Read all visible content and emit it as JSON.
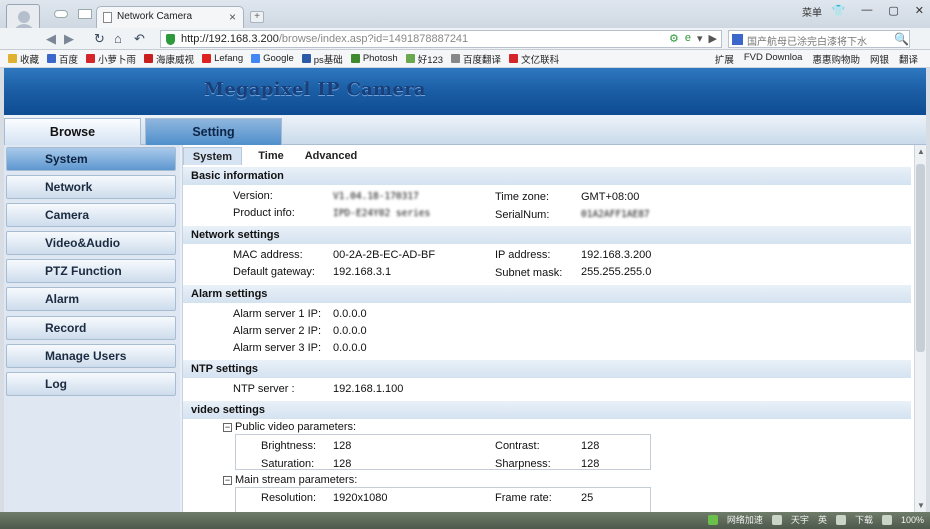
{
  "browser": {
    "tab_title": "Network Camera",
    "new_tab_symbol": "+",
    "menu_label": "菜单",
    "url_host": "http://192.168.3.200",
    "url_path": "/browse/index.asp?id=1491878887241",
    "search_text": "国产航母已涂完白漆将下水",
    "bookmarks": [
      "收藏",
      "百度",
      "小萝卜雨",
      "海康威视",
      "Lefang",
      "Google",
      "ps基础",
      "Photosh",
      "好123",
      "百度翻译",
      "文亿联科"
    ],
    "bookmarks_right": [
      "扩展",
      "FVD Downloa",
      "惠惠购物助",
      "网银",
      "翻译"
    ]
  },
  "app": {
    "banner_title": "Megapixel IP Camera",
    "topnav": {
      "browse": "Browse",
      "setting": "Setting"
    },
    "sidebar": [
      "System",
      "Network",
      "Camera",
      "Video&Audio",
      "PTZ Function",
      "Alarm",
      "Record",
      "Manage Users",
      "Log"
    ],
    "subtabs": {
      "system": "System",
      "time": "Time",
      "advanced": "Advanced"
    },
    "basic": {
      "heading": "Basic information",
      "version_label": "Version:",
      "version_value": "V1.04.18-170317",
      "product_label": "Product info:",
      "product_value": "IPD-E24Y02 series",
      "timezone_label": "Time zone:",
      "timezone_value": "GMT+08:00",
      "serial_label": "SerialNum:",
      "serial_value": "01A2AFF1AE87"
    },
    "network": {
      "heading": "Network settings",
      "mac_label": "MAC address:",
      "mac_value": "00-2A-2B-EC-AD-BF",
      "gateway_label": "Default gateway:",
      "gateway_value": "192.168.3.1",
      "ip_label": "IP address:",
      "ip_value": "192.168.3.200",
      "mask_label": "Subnet mask:",
      "mask_value": "255.255.255.0"
    },
    "alarm": {
      "heading": "Alarm settings",
      "server1_label": "Alarm server 1 IP:",
      "server1_value": "0.0.0.0",
      "server2_label": "Alarm server 2 IP:",
      "server2_value": "0.0.0.0",
      "server3_label": "Alarm server 3 IP:",
      "server3_value": "0.0.0.0"
    },
    "ntp": {
      "heading": "NTP settings",
      "server_label": "NTP server :",
      "server_value": "192.168.1.100"
    },
    "video": {
      "heading": "video settings",
      "public_group": "Public video parameters:",
      "brightness_label": "Brightness:",
      "brightness_value": "128",
      "contrast_label": "Contrast:",
      "contrast_value": "128",
      "saturation_label": "Saturation:",
      "saturation_value": "128",
      "sharpness_label": "Sharpness:",
      "sharpness_value": "128",
      "main_group": "Main stream parameters:",
      "resolution_label": "Resolution:",
      "resolution_value": "1920x1080",
      "framerate_label": "Frame rate:",
      "framerate_value": "25"
    }
  },
  "taskbar": {
    "items": [
      "网络加速",
      "天宇",
      "英",
      "下载",
      "100%"
    ]
  }
}
